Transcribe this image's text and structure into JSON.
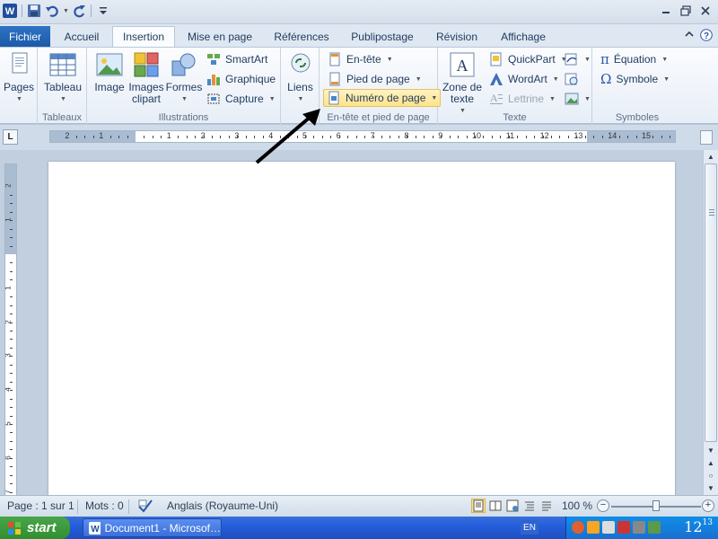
{
  "tabs": {
    "file": "Fichier",
    "items": [
      "Accueil",
      "Insertion",
      "Mise en page",
      "Références",
      "Publipostage",
      "Révision",
      "Affichage"
    ],
    "active": "Insertion"
  },
  "ribbon": {
    "pages": {
      "label": "Pages"
    },
    "tableaux": {
      "table": "Tableau",
      "group": "Tableaux"
    },
    "illustrations": {
      "image": "Image",
      "clipart": "Images clipart",
      "shapes": "Formes",
      "smartart": "SmartArt",
      "chart": "Graphique",
      "capture": "Capture",
      "group": "Illustrations"
    },
    "liens": {
      "label": "Liens"
    },
    "header_footer": {
      "header": "En-tête",
      "footer": "Pied de page",
      "page_number": "Numéro de page",
      "group": "En-tête et pied de page"
    },
    "texte": {
      "textbox": "Zone de texte",
      "quickpart": "QuickPart",
      "wordart": "WordArt",
      "dropcap": "Lettrine",
      "group": "Texte"
    },
    "symboles": {
      "equation": "Équation",
      "symbol": "Symbole",
      "group": "Symboles"
    }
  },
  "ruler": {
    "horizontal": [
      "2",
      "1",
      "1",
      "2",
      "3",
      "4",
      "5",
      "6",
      "7",
      "8",
      "9",
      "10",
      "11",
      "12",
      "13",
      "14",
      "15"
    ],
    "vertical": [
      "2",
      "1",
      "1",
      "2",
      "3",
      "4",
      "5",
      "6",
      "7"
    ]
  },
  "status": {
    "page": "Page : 1 sur 1",
    "words": "Mots : 0",
    "language": "Anglais (Royaume-Uni)",
    "zoom": "100 %",
    "zoom_level": 0.5
  },
  "taskbar": {
    "start": "start",
    "window": "Document1 - Microsof…",
    "lang": "EN",
    "clock_hour": "12",
    "clock_min": "13"
  },
  "colors": {
    "file_tab": "#1b5aa8",
    "highlight": "#ffe38a",
    "taskbar": "#245edb",
    "start": "#2f8f2f"
  }
}
